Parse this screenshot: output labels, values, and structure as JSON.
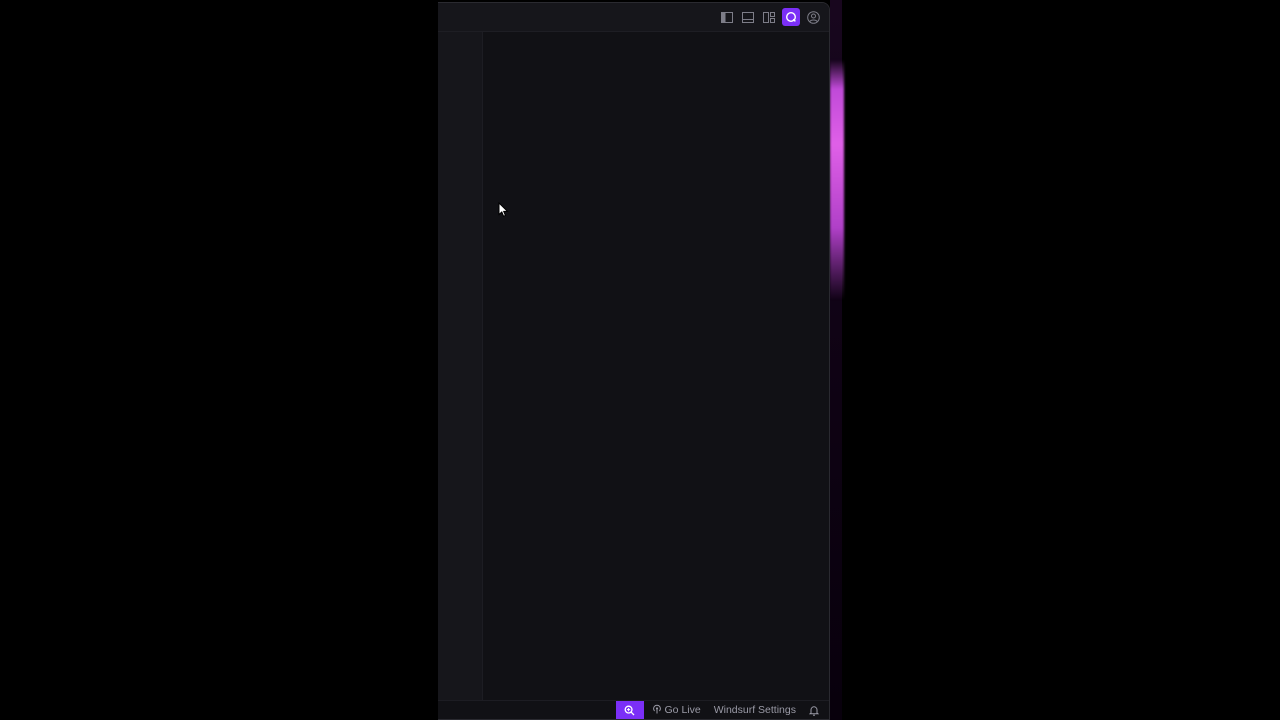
{
  "titlebar": {
    "icons": [
      "sidebar-toggle-icon",
      "panel-toggle-icon",
      "layout-icon",
      "windsurf-icon",
      "account-icon"
    ]
  },
  "statusbar": {
    "search_icon": "search-icon",
    "go_live_icon": "broadcast-icon",
    "go_live_label": "Go Live",
    "settings_label": "Windsurf Settings",
    "bell_icon": "bell-icon"
  },
  "colors": {
    "background": "#000000",
    "editor_bg": "#111115",
    "accent": "#7b2ff7",
    "status_text": "#9a9aa6",
    "glow": "#e060e8"
  }
}
